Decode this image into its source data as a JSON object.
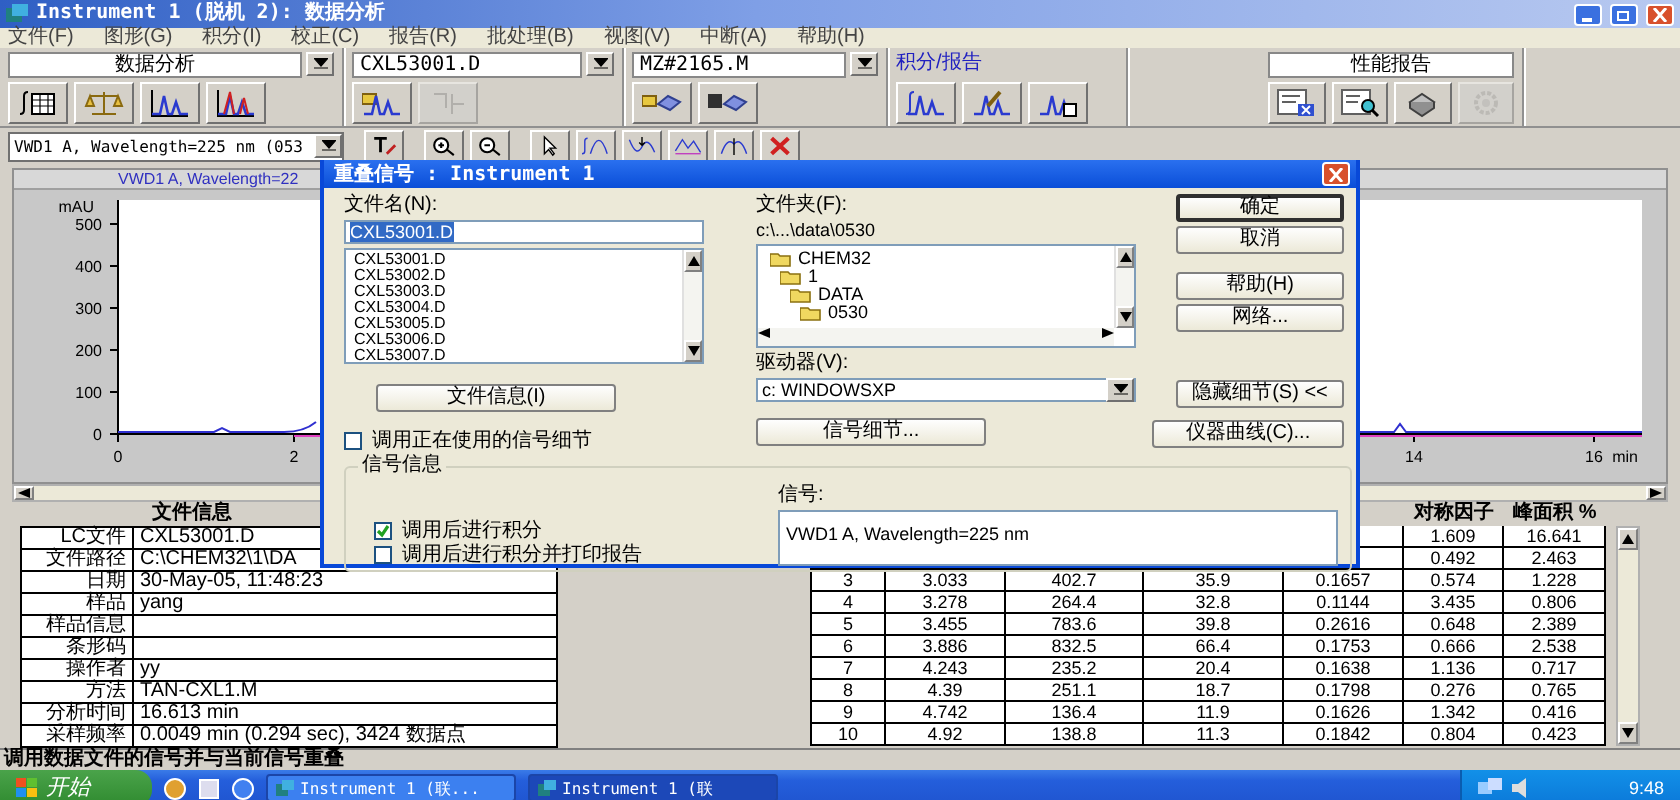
{
  "window": {
    "title": "Instrument 1 (脱机 2): 数据分析"
  },
  "menu": [
    "文件(F)",
    "图形(G)",
    "积分(I)",
    "校正(C)",
    "报告(R)",
    "批处理(B)",
    "视图(V)",
    "中断(A)",
    "帮助(H)"
  ],
  "toolbar": {
    "groups": [
      {
        "kind": "combo",
        "value": "数据分析",
        "buttons": [
          {
            "disabled": false
          },
          {
            "disabled": false
          },
          {
            "disabled": false
          },
          {
            "disabled": false
          }
        ]
      },
      {
        "kind": "combo",
        "value": "CXL53001.D",
        "buttons": [
          {
            "disabled": false
          },
          {
            "disabled": true
          }
        ]
      },
      {
        "kind": "combo",
        "value": "MZ#2165.M",
        "buttons": [
          {
            "disabled": false
          },
          {
            "disabled": false
          }
        ]
      },
      {
        "kind": "label",
        "value": "积分/报告",
        "buttons": [
          {
            "disabled": false
          },
          {
            "disabled": false
          },
          {
            "disabled": false
          }
        ]
      },
      {
        "kind": "field",
        "value": "性能报告",
        "buttons": [
          {
            "disabled": false
          },
          {
            "disabled": false
          },
          {
            "disabled": false
          },
          {
            "disabled": true
          }
        ]
      }
    ]
  },
  "signal_select": {
    "value": "VWD1 A, Wavelength=225 nm (053"
  },
  "chart": {
    "title": "VWD1 A, Wavelength=22",
    "y_unit": "mAU",
    "y_ticks": [
      "500",
      "400",
      "300",
      "200",
      "100",
      "0"
    ],
    "x_ticks": [
      "0",
      "2",
      "14",
      "16"
    ],
    "x_unit": "min"
  },
  "file_info": {
    "title": "文件信息",
    "rows": [
      {
        "label": "LC文件",
        "value": "CXL53001.D"
      },
      {
        "label": "文件路径",
        "value": "C:\\CHEM32\\1\\DA"
      },
      {
        "label": "日期",
        "value": "30-May-05, 11:48:23"
      },
      {
        "label": "样品",
        "value": "yang"
      },
      {
        "label": "样品信息"
      },
      {
        "label": "条形码"
      },
      {
        "label": "操作者",
        "value": "yy"
      },
      {
        "label": "方法",
        "value": "TAN-CXL1.M"
      },
      {
        "label": "分析时间",
        "value": "16.613 min"
      },
      {
        "label": "采样频率",
        "value": "0.0049 min (0.294 sec), 3424 数据点"
      }
    ]
  },
  "peak_table": {
    "columns": [
      null,
      null,
      null,
      null,
      null,
      "对称因子",
      "峰面积 %"
    ],
    "rows": [
      {
        "cells": [
          null,
          null,
          null,
          null,
          null,
          "1.609",
          "16.641"
        ]
      },
      {
        "cells": [
          null,
          null,
          null,
          null,
          null,
          "0.492",
          "2.463"
        ]
      },
      {
        "cells": [
          "3",
          "3.033",
          "402.7",
          "35.9",
          "0.1657",
          "0.574",
          "1.228"
        ]
      },
      {
        "cells": [
          "4",
          "3.278",
          "264.4",
          "32.8",
          "0.1144",
          "3.435",
          "0.806"
        ]
      },
      {
        "cells": [
          "5",
          "3.455",
          "783.6",
          "39.8",
          "0.2616",
          "0.648",
          "2.389"
        ]
      },
      {
        "cells": [
          "6",
          "3.886",
          "832.5",
          "66.4",
          "0.1753",
          "0.666",
          "2.538"
        ]
      },
      {
        "cells": [
          "7",
          "4.243",
          "235.2",
          "20.4",
          "0.1638",
          "1.136",
          "0.717"
        ]
      },
      {
        "cells": [
          "8",
          "4.39",
          "251.1",
          "18.7",
          "0.1798",
          "0.276",
          "0.765"
        ]
      },
      {
        "cells": [
          "9",
          "4.742",
          "136.4",
          "11.9",
          "0.1626",
          "1.342",
          "0.416"
        ]
      },
      {
        "cells": [
          "10",
          "4.92",
          "138.8",
          "11.3",
          "0.1842",
          "0.804",
          "0.423"
        ]
      }
    ]
  },
  "dialog": {
    "title": "重叠信号 : Instrument 1",
    "file_name": {
      "label": "文件名(N):",
      "value": "CXL53001.D",
      "text_selected": true
    },
    "files": [
      "CXL53001.D",
      "CXL53002.D",
      "CXL53003.D",
      "CXL53004.D",
      "CXL53005.D",
      "CXL53006.D",
      "CXL53007.D"
    ],
    "file_info_button": "文件信息(I)",
    "use_current": {
      "label": "调用正在使用的信号细节",
      "checked": false
    },
    "folder": {
      "label": "文件夹(F):",
      "path": "c:\\...\\data\\0530",
      "tree": [
        {
          "name": "CHEM32",
          "children": [
            {
              "name": "1",
              "children": [
                {
                  "name": "DATA",
                  "children": [
                    {
                      "name": "0530"
                    }
                  ]
                }
              ]
            }
          ]
        }
      ]
    },
    "drive": {
      "label": "驱动器(V):",
      "value": "c: WINDOWSXP"
    },
    "signal_details_button": "信号细节...",
    "buttons": [
      {
        "label": "确定",
        "default": true
      },
      {
        "label": "取消",
        "default": false
      },
      {
        "label": "帮助(H)",
        "default": false
      },
      {
        "label": "网络...",
        "default": false
      },
      {
        "label": "隐藏细节(S) <<",
        "default": false
      },
      {
        "label": "仪器曲线(C)...",
        "default": false
      }
    ],
    "group": {
      "title": "信号信息",
      "signal_label": "信号:",
      "signal_value": "VWD1 A, Wavelength=225 nm",
      "options": [
        {
          "label": "调用后进行积分",
          "checked": true
        },
        {
          "label": "调用后进行积分并打印报告",
          "checked": false
        }
      ]
    }
  },
  "status_bar": {
    "text": "调用数据文件的信号并与当前信号重叠"
  },
  "taskbar": {
    "start": "开始",
    "tasks": [
      {
        "label": "Instrument 1 (联...",
        "selected": false
      },
      {
        "label": "Instrument 1 (联",
        "selected": true
      }
    ],
    "clock": "9:48"
  }
}
